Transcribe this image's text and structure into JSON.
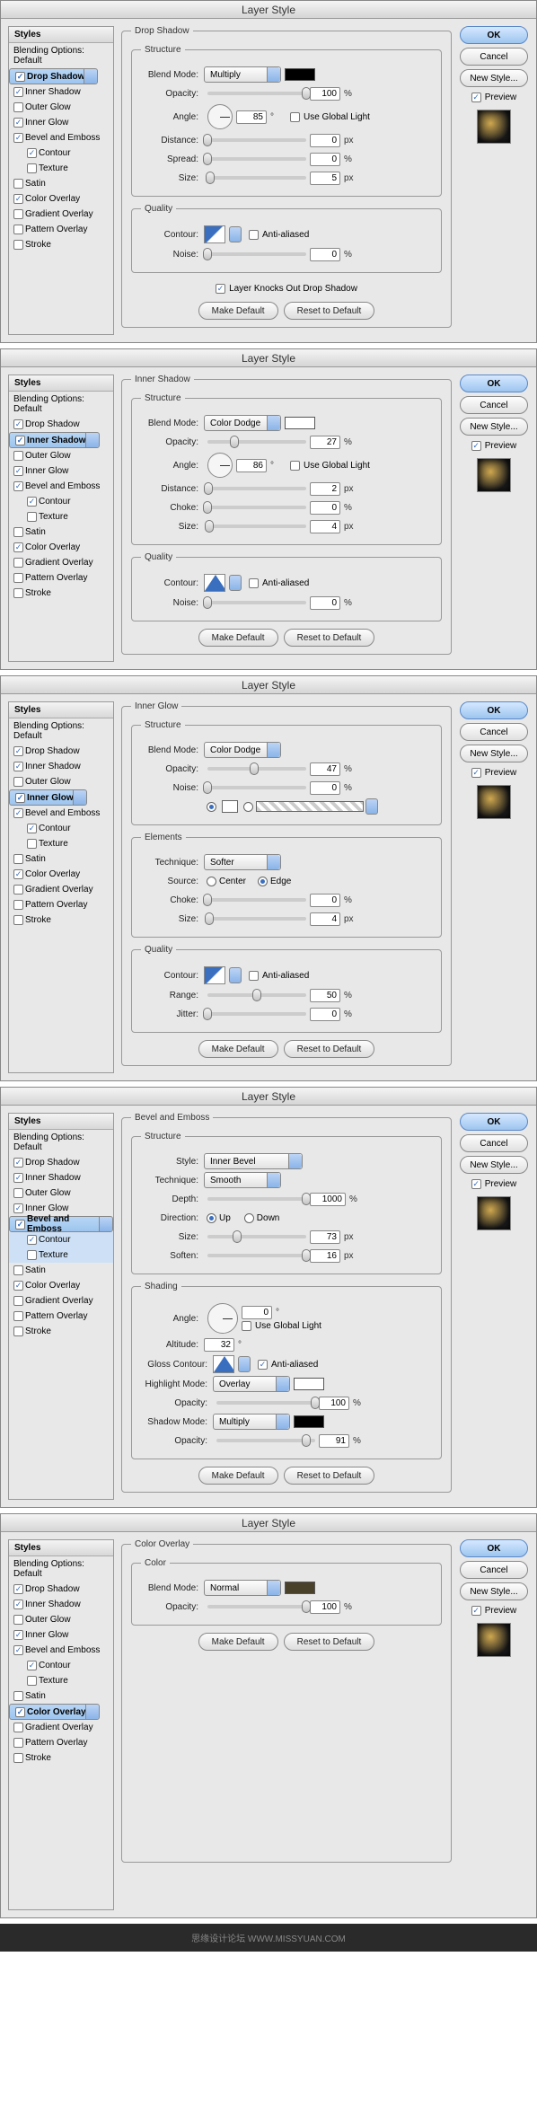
{
  "common": {
    "title": "Layer Style",
    "styles_hdr": "Styles",
    "blending": "Blending Options: Default",
    "items": {
      "dropShadow": "Drop Shadow",
      "innerShadow": "Inner Shadow",
      "outerGlow": "Outer Glow",
      "innerGlow": "Inner Glow",
      "bevel": "Bevel and Emboss",
      "contour": "Contour",
      "texture": "Texture",
      "satin": "Satin",
      "colorOverlay": "Color Overlay",
      "gradientOverlay": "Gradient Overlay",
      "patternOverlay": "Pattern Overlay",
      "stroke": "Stroke"
    },
    "buttons": {
      "ok": "OK",
      "cancel": "Cancel",
      "newStyle": "New Style...",
      "preview": "Preview",
      "makeDefault": "Make Default",
      "reset": "Reset to Default"
    },
    "labels": {
      "structure": "Structure",
      "quality": "Quality",
      "elements": "Elements",
      "shading": "Shading",
      "color": "Color",
      "blendMode": "Blend Mode:",
      "opacity": "Opacity:",
      "angle": "Angle:",
      "useGlobal": "Use Global Light",
      "distance": "Distance:",
      "spread": "Spread:",
      "size": "Size:",
      "choke": "Choke:",
      "contour": "Contour:",
      "anti": "Anti-aliased",
      "noise": "Noise:",
      "knocks": "Layer Knocks Out Drop Shadow",
      "technique": "Technique:",
      "source": "Source:",
      "center": "Center",
      "edge": "Edge",
      "range": "Range:",
      "jitter": "Jitter:",
      "style": "Style:",
      "depth": "Depth:",
      "direction": "Direction:",
      "up": "Up",
      "down": "Down",
      "soften": "Soften:",
      "altitude": "Altitude:",
      "glossContour": "Gloss Contour:",
      "highlightMode": "Highlight Mode:",
      "shadowMode": "Shadow Mode:",
      "pct": "%",
      "px": "px",
      "deg": "°"
    }
  },
  "p1": {
    "panel": "Drop Shadow",
    "mode": "Multiply",
    "modeColor": "#000000",
    "opacity": "100",
    "angle": "85",
    "distance": "0",
    "spread": "0",
    "size": "5",
    "noise": "0"
  },
  "p2": {
    "panel": "Inner Shadow",
    "mode": "Color Dodge",
    "modeColor": "#ffffff",
    "opacity": "27",
    "angle": "86",
    "distance": "2",
    "choke": "0",
    "size": "4",
    "noise": "0"
  },
  "p3": {
    "panel": "Inner Glow",
    "mode": "Color Dodge",
    "opacity": "47",
    "noise": "0",
    "technique": "Softer",
    "choke": "0",
    "size": "4",
    "range": "50",
    "jitter": "0"
  },
  "p4": {
    "panel": "Bevel and Emboss",
    "style": "Inner Bevel",
    "technique": "Smooth",
    "depth": "1000",
    "size": "73",
    "soften": "16",
    "angle": "0",
    "altitude": "32",
    "hmode": "Overlay",
    "hopacity": "100",
    "smode": "Multiply",
    "sopacity": "91"
  },
  "p5": {
    "panel": "Color Overlay",
    "mode": "Normal",
    "modeColor": "#4a412a",
    "opacity": "100"
  },
  "footer": "思缘设计论坛   WWW.MISSYUAN.COM"
}
